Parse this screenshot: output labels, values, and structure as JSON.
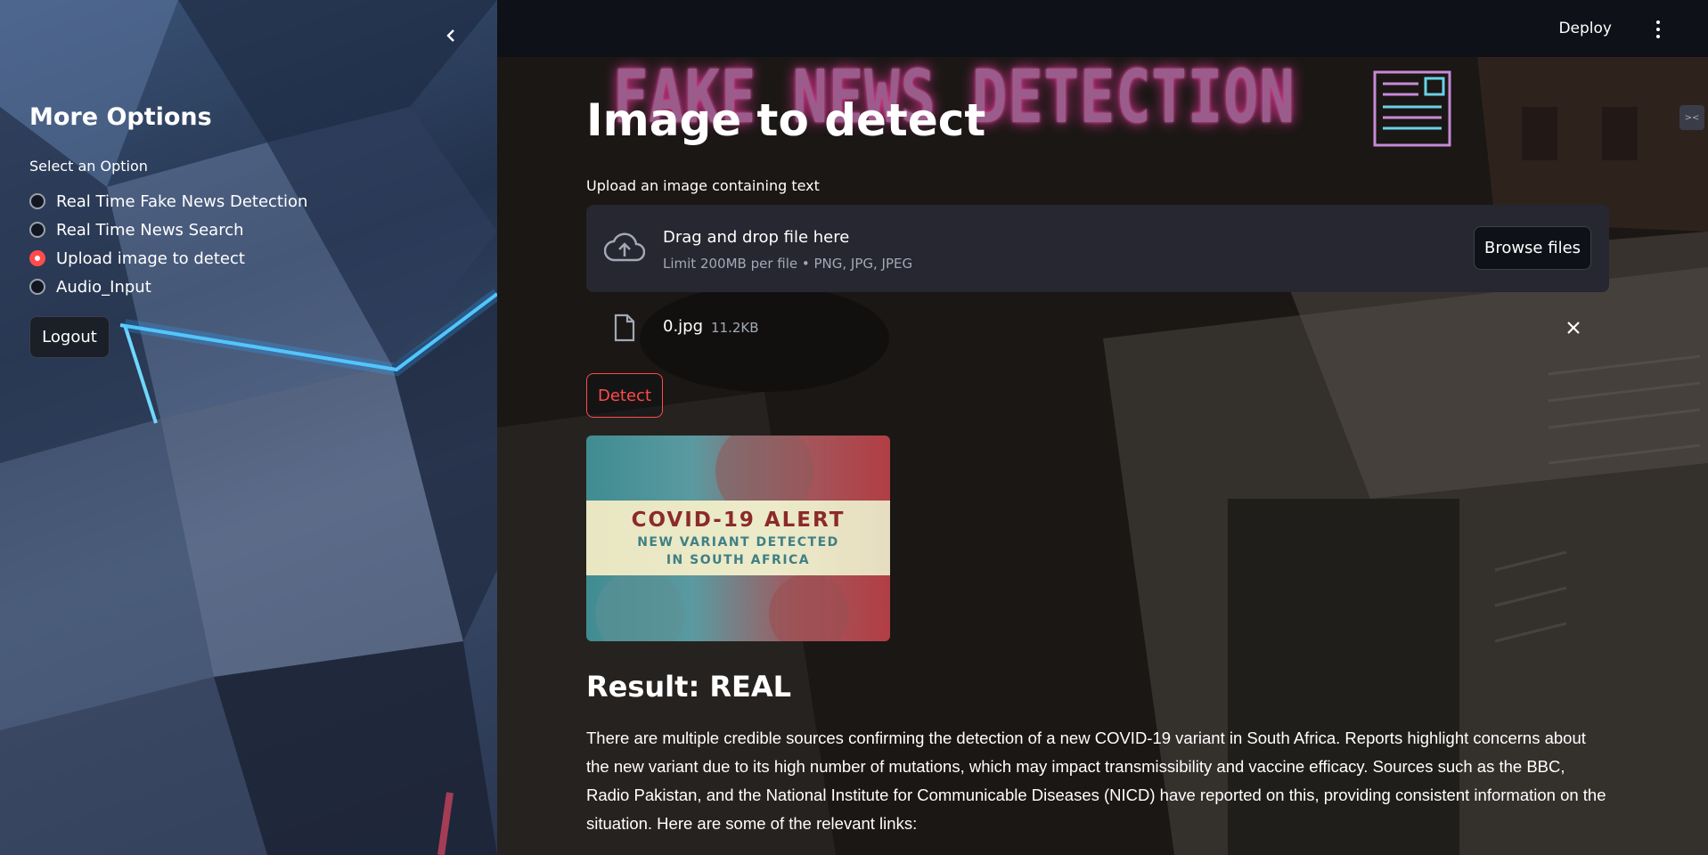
{
  "sidebar": {
    "title": "More Options",
    "select_label": "Select an Option",
    "options": [
      {
        "label": "Real Time Fake News Detection",
        "selected": false
      },
      {
        "label": "Real Time News Search",
        "selected": false
      },
      {
        "label": "Upload image to detect",
        "selected": true
      },
      {
        "label": "Audio_Input",
        "selected": false
      }
    ],
    "logout_label": "Logout"
  },
  "header": {
    "deploy_label": "Deploy",
    "menu_icon": "kebab-menu-icon"
  },
  "banner": {
    "text": "FAKE NEWS DETECTION"
  },
  "main": {
    "title": "Image to detect",
    "upload_label": "Upload an image containing text",
    "dropzone": {
      "title": "Drag and drop file here",
      "limits": "Limit 200MB per file • PNG, JPG, JPEG",
      "browse_label": "Browse files"
    },
    "file": {
      "name": "0.jpg",
      "size": "11.2KB"
    },
    "detect_label": "Detect",
    "preview": {
      "line1": "COVID-19 ALERT",
      "line2": "NEW VARIANT DETECTED",
      "line3": "IN SOUTH AFRICA"
    },
    "result_title": "Result: REAL",
    "result_text": "There are multiple credible sources confirming the detection of a new COVID-19 variant in South Africa. Reports highlight concerns about the new variant due to its high number of mutations, which may impact transmissibility and vaccine efficacy. Sources such as the BBC, Radio Pakistan, and the National Institute for Communicable Diseases (NICD) have reported on this, providing consistent information on the situation. Here are some of the relevant links:"
  },
  "colors": {
    "accent": "#ff4b4b",
    "background": "#0e1117",
    "dropzone": "#262730"
  }
}
